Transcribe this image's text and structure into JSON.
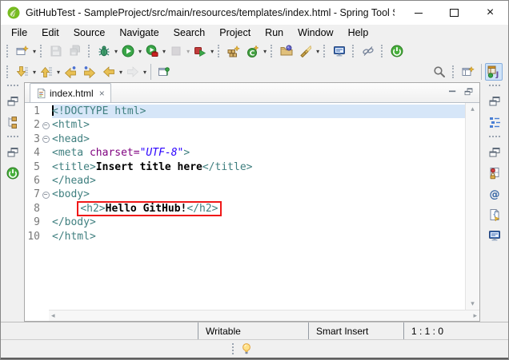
{
  "window": {
    "title": "GitHubTest - SampleProject/src/main/resources/templates/index.html - Spring Tool Sui...",
    "controls": {
      "close_glyph": "×"
    }
  },
  "menu": {
    "items": [
      "File",
      "Edit",
      "Source",
      "Navigate",
      "Search",
      "Project",
      "Run",
      "Window",
      "Help"
    ]
  },
  "glyphs": {
    "dropdown": "▾",
    "scroll_up": "▴",
    "scroll_down": "▾",
    "scroll_left": "◂",
    "scroll_right": "▸",
    "fold_minus": "−",
    "tab_close": "×"
  },
  "toolbar": {
    "row1_icons": [
      "new-wizard",
      "save",
      "save-all",
      "debug",
      "run",
      "run-external-tools",
      "stop",
      "relaunch",
      "new-java-project",
      "new-java-class",
      "open-type",
      "search-torch",
      "open-console",
      "link-with-editor",
      "spring-boot"
    ],
    "row2_icons": [
      "next-annotation",
      "previous-annotation",
      "last-edit-location",
      "next-edit-location",
      "back",
      "forward",
      "pin-editor"
    ],
    "row2_right_icons": [
      "search",
      "open-perspective",
      "java-perspective"
    ]
  },
  "left_strip_icons": [
    "restore-view",
    "package-explorer",
    "restore-view",
    "boot-dashboard"
  ],
  "right_strip_icons": [
    "restore-view",
    "outline",
    "restore-view",
    "servers",
    "javadoc",
    "declaration",
    "console"
  ],
  "editor": {
    "tab_label": "index.html",
    "lines": [
      {
        "num": "1",
        "current": true,
        "cursor": true,
        "segs": [
          [
            "<!DOCTYPE html>",
            "tag"
          ]
        ]
      },
      {
        "num": "2",
        "fold": true,
        "segs": [
          [
            "<html>",
            "tag"
          ]
        ]
      },
      {
        "num": "3",
        "fold": true,
        "segs": [
          [
            "<head>",
            "tag"
          ]
        ]
      },
      {
        "num": "4",
        "segs": [
          [
            "<meta ",
            "tag"
          ],
          [
            "charset=",
            "attr"
          ],
          [
            "\"UTF-8\"",
            "val"
          ],
          [
            ">",
            "tag"
          ]
        ]
      },
      {
        "num": "5",
        "segs": [
          [
            "<title>",
            "tag"
          ],
          [
            "Insert title here",
            "text"
          ],
          [
            "</title>",
            "tag"
          ]
        ]
      },
      {
        "num": "6",
        "segs": [
          [
            "</head>",
            "tag"
          ]
        ]
      },
      {
        "num": "7",
        "fold": true,
        "segs": [
          [
            "<body>",
            "tag"
          ]
        ]
      },
      {
        "num": "8",
        "segs": [
          [
            "    ",
            "plain"
          ]
        ],
        "boxed": [
          [
            "<h2>",
            "tag"
          ],
          [
            "Hello GitHub!",
            "text"
          ],
          [
            "</h2>",
            "tag"
          ]
        ]
      },
      {
        "num": "9",
        "segs": [
          [
            "</body>",
            "tag"
          ]
        ]
      },
      {
        "num": "10",
        "segs": [
          [
            "</html>",
            "tag"
          ]
        ]
      }
    ]
  },
  "statusbar": {
    "writable": "Writable",
    "insert_mode": "Smart Insert",
    "caret_position": "1 : 1 : 0"
  },
  "colors": {
    "tag": "#3f7f7f",
    "attribute_name": "#7f007f",
    "attribute_value": "#2a00ff",
    "current_line_highlight": "#d6e6f8",
    "annotation_box": "#f01818",
    "spring_green": "#48b03c"
  }
}
